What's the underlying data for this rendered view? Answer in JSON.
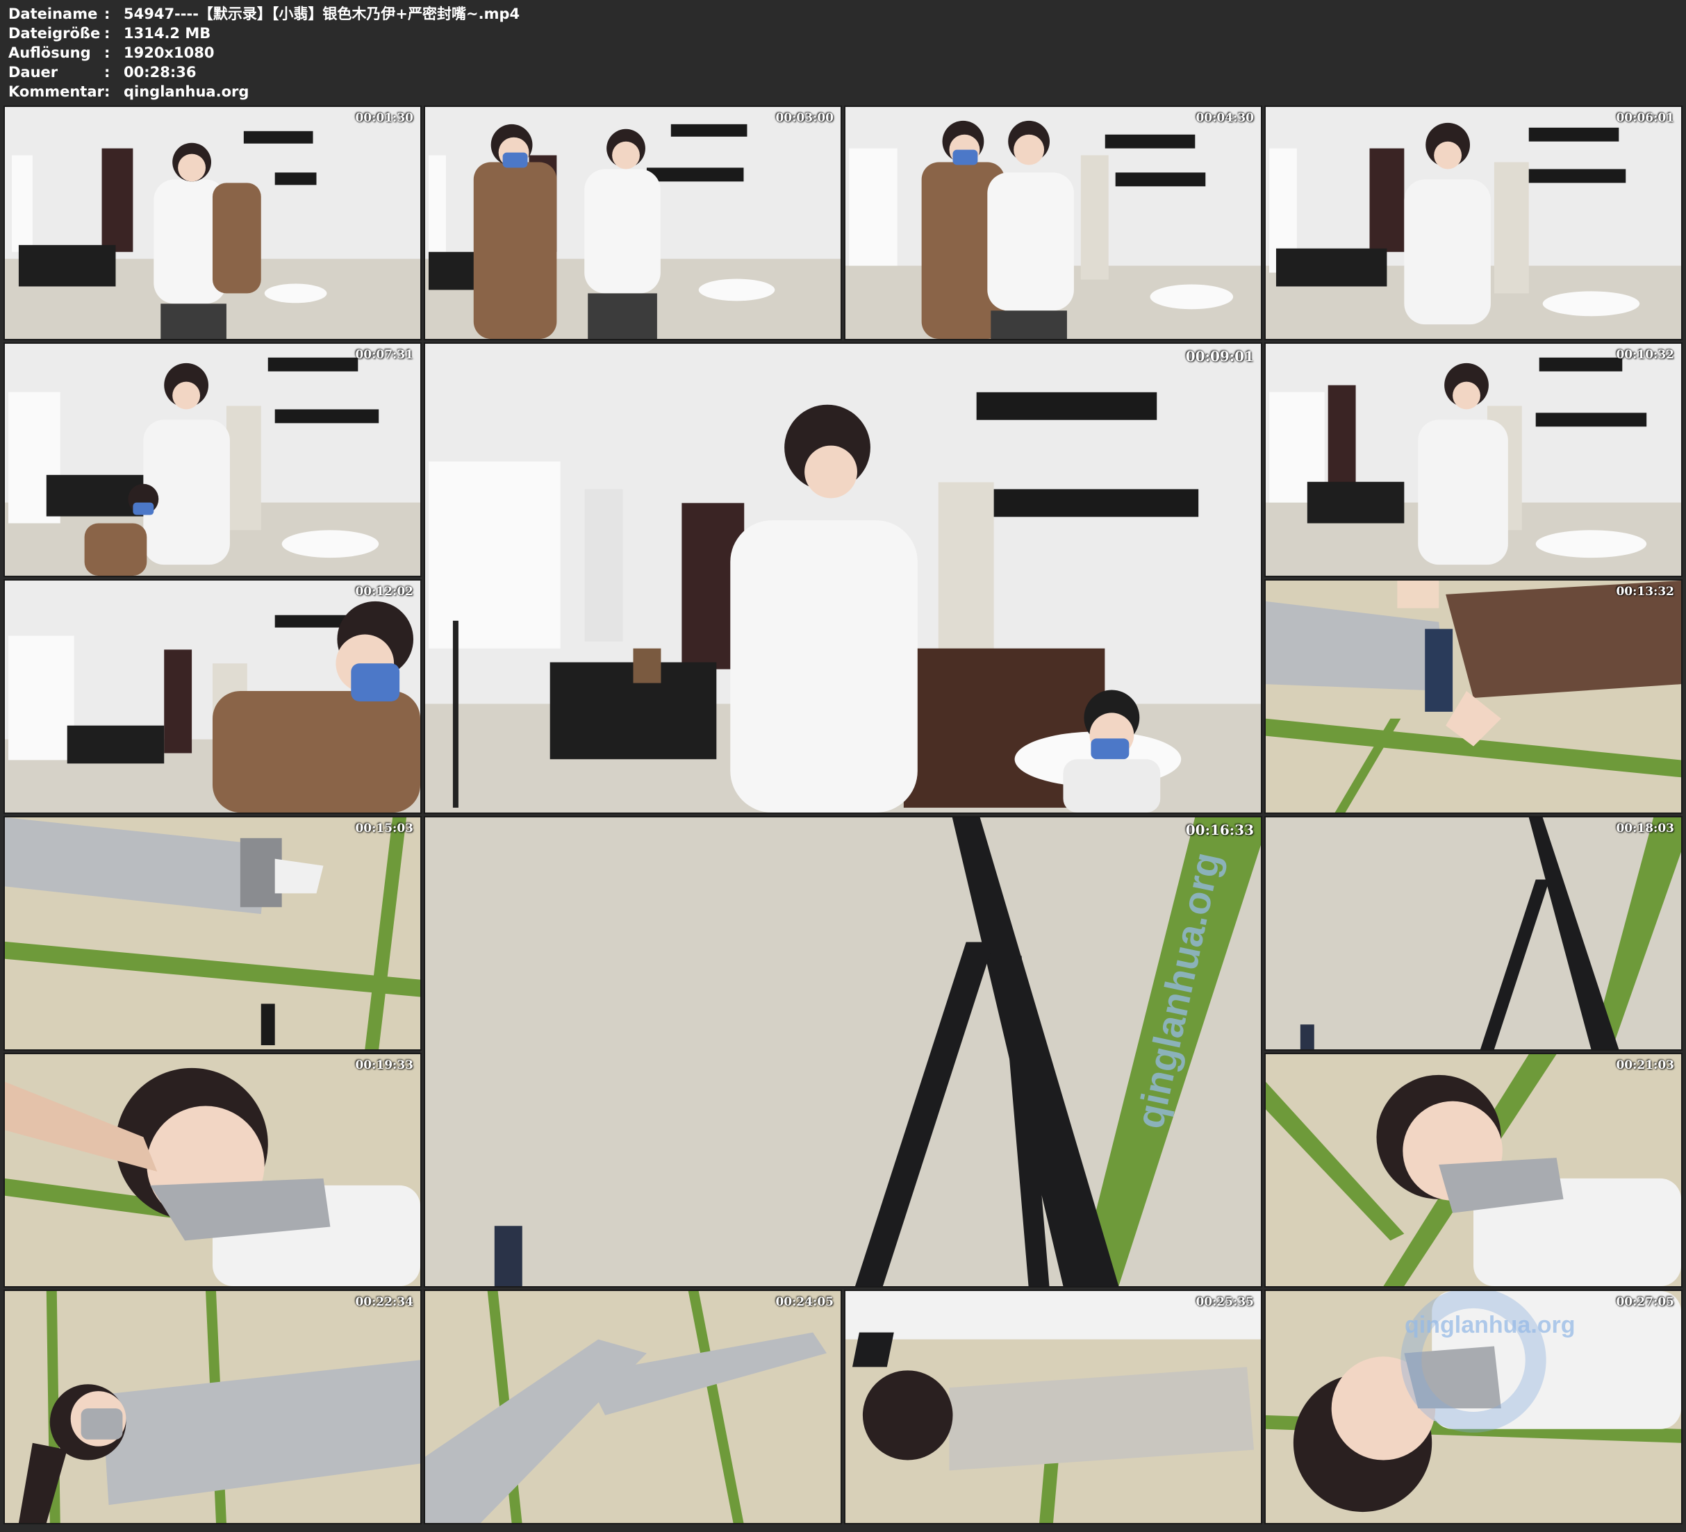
{
  "meta": [
    {
      "label": "Dateiname",
      "value": "54947----【默示录】【小翡】银色木乃伊+严密封嘴~.mp4"
    },
    {
      "label": "Dateigröße",
      "value": "1314.2 MB"
    },
    {
      "label": "Auflösung",
      "value": "1920x1080"
    },
    {
      "label": "Dauer",
      "value": "00:28:36"
    },
    {
      "label": "Kommentar",
      "value": "qinglanhua.org"
    }
  ],
  "separator": ":",
  "thumbnails": [
    {
      "time": "00:01:30",
      "scene": "room-standing"
    },
    {
      "time": "00:03:00",
      "scene": "room-standing"
    },
    {
      "time": "00:04:30",
      "scene": "room-standing"
    },
    {
      "time": "00:06:01",
      "scene": "room-standing"
    },
    {
      "time": "00:07:31",
      "scene": "room-standing"
    },
    {
      "time": "00:09:01",
      "scene": "room-standing"
    },
    {
      "time": "00:10:32",
      "scene": "room-standing"
    },
    {
      "time": "00:12:02",
      "scene": "room-standing"
    },
    {
      "time": "00:13:32",
      "scene": "floor-wrapped"
    },
    {
      "time": "00:15:03",
      "scene": "floor-wrapped"
    },
    {
      "time": "00:16:33",
      "scene": "floor-tripod"
    },
    {
      "time": "00:18:03",
      "scene": "floor-tripod"
    },
    {
      "time": "00:19:33",
      "scene": "floor-face"
    },
    {
      "time": "00:21:03",
      "scene": "floor-face"
    },
    {
      "time": "00:22:34",
      "scene": "floor-wrapped"
    },
    {
      "time": "00:24:05",
      "scene": "floor-wrapped"
    },
    {
      "time": "00:25:35",
      "scene": "floor-wrapped"
    },
    {
      "time": "00:27:05",
      "scene": "floor-face"
    }
  ],
  "watermark": "qinglanhua.org",
  "colors": {
    "background": "#2b2b2b",
    "text": "#ffffff",
    "wall": "#ededed",
    "mat": "#d8d0b8",
    "tape": "#b9bcc0"
  }
}
